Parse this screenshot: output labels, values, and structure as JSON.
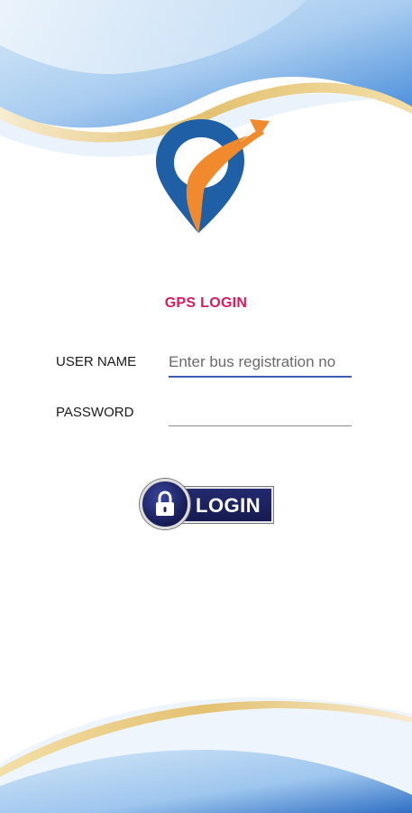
{
  "login": {
    "title": "GPS LOGIN",
    "username_label": "USER NAME",
    "username_placeholder": "Enter bus registration no",
    "username_value": "",
    "password_label": "PASSWORD",
    "password_value": "",
    "button_label": "LOGIN"
  },
  "icons": {
    "logo": "location-pin-arrow-logo",
    "button": "lock-icon"
  },
  "colors": {
    "title": "#d81b60",
    "button_background": "#1b2060",
    "wave_blue": "#3f86d8",
    "wave_gold": "#e3c170"
  }
}
